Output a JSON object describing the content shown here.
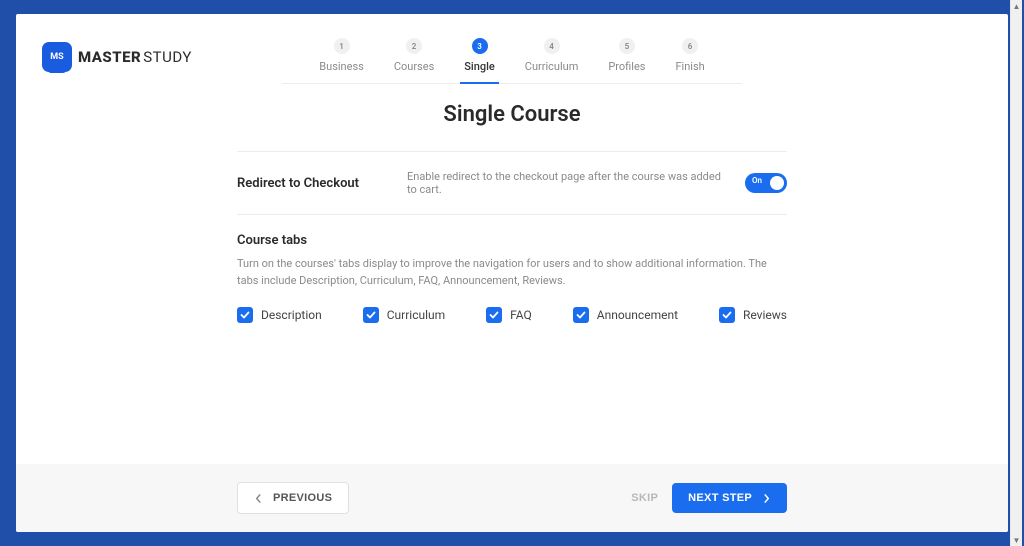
{
  "logo": {
    "badge": "MS",
    "text_bold": "MASTER",
    "text_light": "STUDY"
  },
  "stepper": [
    {
      "num": "1",
      "label": "Business"
    },
    {
      "num": "2",
      "label": "Courses"
    },
    {
      "num": "3",
      "label": "Single"
    },
    {
      "num": "4",
      "label": "Curriculum"
    },
    {
      "num": "5",
      "label": "Profiles"
    },
    {
      "num": "6",
      "label": "Finish"
    }
  ],
  "active_step": 2,
  "page_title": "Single Course",
  "redirect": {
    "label": "Redirect to Checkout",
    "desc": "Enable redirect to the checkout page after the course was added to cart.",
    "toggle_text": "On"
  },
  "tabs_section": {
    "title": "Course tabs",
    "desc": "Turn on the courses' tabs display to improve the navigation for users and to show additional information. The tabs include Description, Curriculum, FAQ, Announcement, Reviews."
  },
  "tabs": [
    {
      "label": "Description"
    },
    {
      "label": "Curriculum"
    },
    {
      "label": "FAQ"
    },
    {
      "label": "Announcement"
    },
    {
      "label": "Reviews"
    }
  ],
  "buttons": {
    "previous": "PREVIOUS",
    "skip": "SKIP",
    "next": "NEXT STEP"
  }
}
